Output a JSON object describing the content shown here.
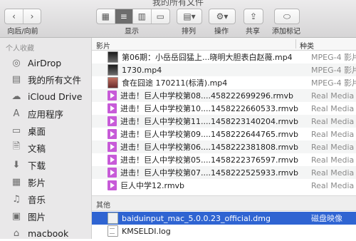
{
  "window": {
    "title": "我的所有文件"
  },
  "toolbar": {
    "nav_label": "向后/向前",
    "view_label": "显示",
    "sort_label": "排列",
    "action_label": "操作",
    "share_label": "共享",
    "tag_label": "添加标记"
  },
  "sidebar": {
    "heading": "个人收藏",
    "items": [
      {
        "label": "AirDrop",
        "icon": "airdrop-icon"
      },
      {
        "label": "我的所有文件",
        "icon": "all-files-icon",
        "selected": true
      },
      {
        "label": "iCloud Drive",
        "icon": "cloud-icon"
      },
      {
        "label": "应用程序",
        "icon": "applications-icon"
      },
      {
        "label": "桌面",
        "icon": "desktop-icon"
      },
      {
        "label": "文稿",
        "icon": "documents-icon"
      },
      {
        "label": "下载",
        "icon": "downloads-icon"
      },
      {
        "label": "影片",
        "icon": "movies-icon"
      },
      {
        "label": "音乐",
        "icon": "music-icon"
      },
      {
        "label": "图片",
        "icon": "pictures-icon"
      },
      {
        "label": "macbook",
        "icon": "home-icon"
      }
    ]
  },
  "columns": {
    "name": "影片",
    "kind": "种类"
  },
  "groups": {
    "movies": [
      {
        "name": "第06期：小岳岳囧猛上...晓明大胆表白赵薇.mp4",
        "kind": "MPEG-4 影片",
        "icon": "video"
      },
      {
        "name": "1730.mp4",
        "kind": "MPEG-4 影片",
        "icon": "video"
      },
      {
        "name": "食在囧途 170211(标清).mp4",
        "kind": "MPEG-4 影片",
        "icon": "video2"
      },
      {
        "name": "进击！巨人中学校第08....458222699296.rmvb",
        "kind": "Real Media",
        "icon": "rm"
      },
      {
        "name": "进击！巨人中学校第10....1458222660533.rmvb",
        "kind": "Real Media",
        "icon": "rm"
      },
      {
        "name": "进击！巨人中学校第11....1458223140204.rmvb",
        "kind": "Real Media",
        "icon": "rm"
      },
      {
        "name": "进击！巨人中学校第09....1458222644765.rmvb",
        "kind": "Real Media",
        "icon": "rm"
      },
      {
        "name": "进击！巨人中学校第06....1458222381808.rmvb",
        "kind": "Real Media",
        "icon": "rm"
      },
      {
        "name": "进击！巨人中学校第05....1458222376597.rmvb",
        "kind": "Real Media",
        "icon": "rm"
      },
      {
        "name": "进击！巨人中学校第07....1458222525933.rmvb",
        "kind": "Real Media",
        "icon": "rm"
      },
      {
        "name": "巨人中学12.rmvb",
        "kind": "Real Media",
        "icon": "rm"
      }
    ],
    "other_heading": "其他",
    "other": [
      {
        "name": "baiduinput_mac_5.0.0.23_official.dmg",
        "kind": "磁盘映像",
        "icon": "dmg",
        "selected": true
      },
      {
        "name": "KMSELDI.log",
        "kind": "",
        "icon": "doc"
      }
    ]
  }
}
